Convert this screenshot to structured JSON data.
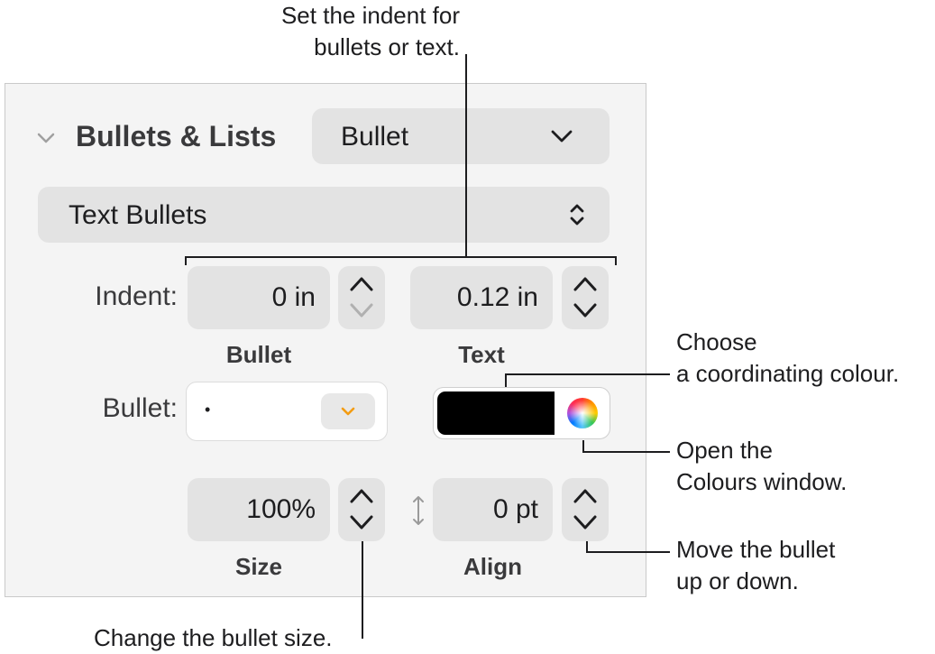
{
  "callouts": {
    "indent": [
      "Set the indent for",
      "bullets or text."
    ],
    "colour": [
      "Choose",
      "a coordinating colour."
    ],
    "colours_window": [
      "Open the",
      "Colours window."
    ],
    "move": [
      "Move the bullet",
      "up or down."
    ],
    "size": "Change the bullet size."
  },
  "panel": {
    "section_title": "Bullets & Lists",
    "list_style": "Bullet",
    "bullet_type": "Text Bullets",
    "indent_label": "Indent:",
    "indent_bullet_value": "0 in",
    "indent_text_value": "0.12 in",
    "indent_bullet_caption": "Bullet",
    "indent_text_caption": "Text",
    "bullet_label": "Bullet:",
    "bullet_char": "•",
    "bullet_color": "#000000",
    "size_value": "100%",
    "size_caption": "Size",
    "align_value": "0 pt",
    "align_caption": "Align"
  },
  "colors": {
    "chevron_accent": "#f39c12",
    "panel_bg": "#f4f4f4",
    "field_bg": "#e3e3e3"
  },
  "icons": [
    "disclosure-chevron-icon",
    "chevron-down-icon",
    "up-down-arrows-icon",
    "stepper-up-icon",
    "stepper-down-icon",
    "colour-wheel-icon",
    "vertical-arrow-icon"
  ]
}
